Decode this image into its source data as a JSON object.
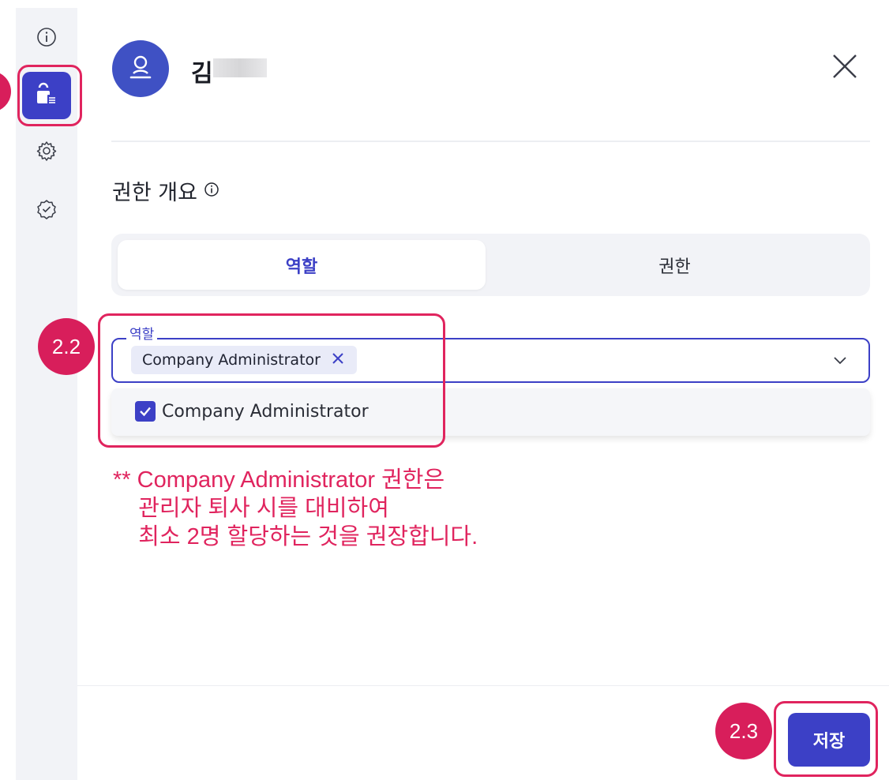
{
  "sidebar": {
    "items": [
      {
        "icon": "info-circle-icon"
      },
      {
        "icon": "unlock-list-icon",
        "active": true
      },
      {
        "icon": "gear-icon"
      },
      {
        "icon": "verified-badge-icon"
      }
    ]
  },
  "header": {
    "user_name": "김"
  },
  "section": {
    "title": "권한 개요"
  },
  "tabs": [
    {
      "label": "역할",
      "active": true
    },
    {
      "label": "권한",
      "active": false
    }
  ],
  "role_select": {
    "legend": "역할",
    "selected_chip": "Company Administrator",
    "options": [
      {
        "label": "Company Administrator",
        "checked": true
      }
    ]
  },
  "annotations": {
    "badges": [
      "2.2",
      "2.3"
    ],
    "note": "** Company Administrator 권한은\n    관리자 퇴사 시를 대비하여\n    최소 2명 할당하는 것을 권장합니다."
  },
  "footer": {
    "save_label": "저장"
  },
  "colors": {
    "accent": "#3c40c6",
    "annotation": "#e0245e",
    "rail": "#f2f3f7"
  }
}
